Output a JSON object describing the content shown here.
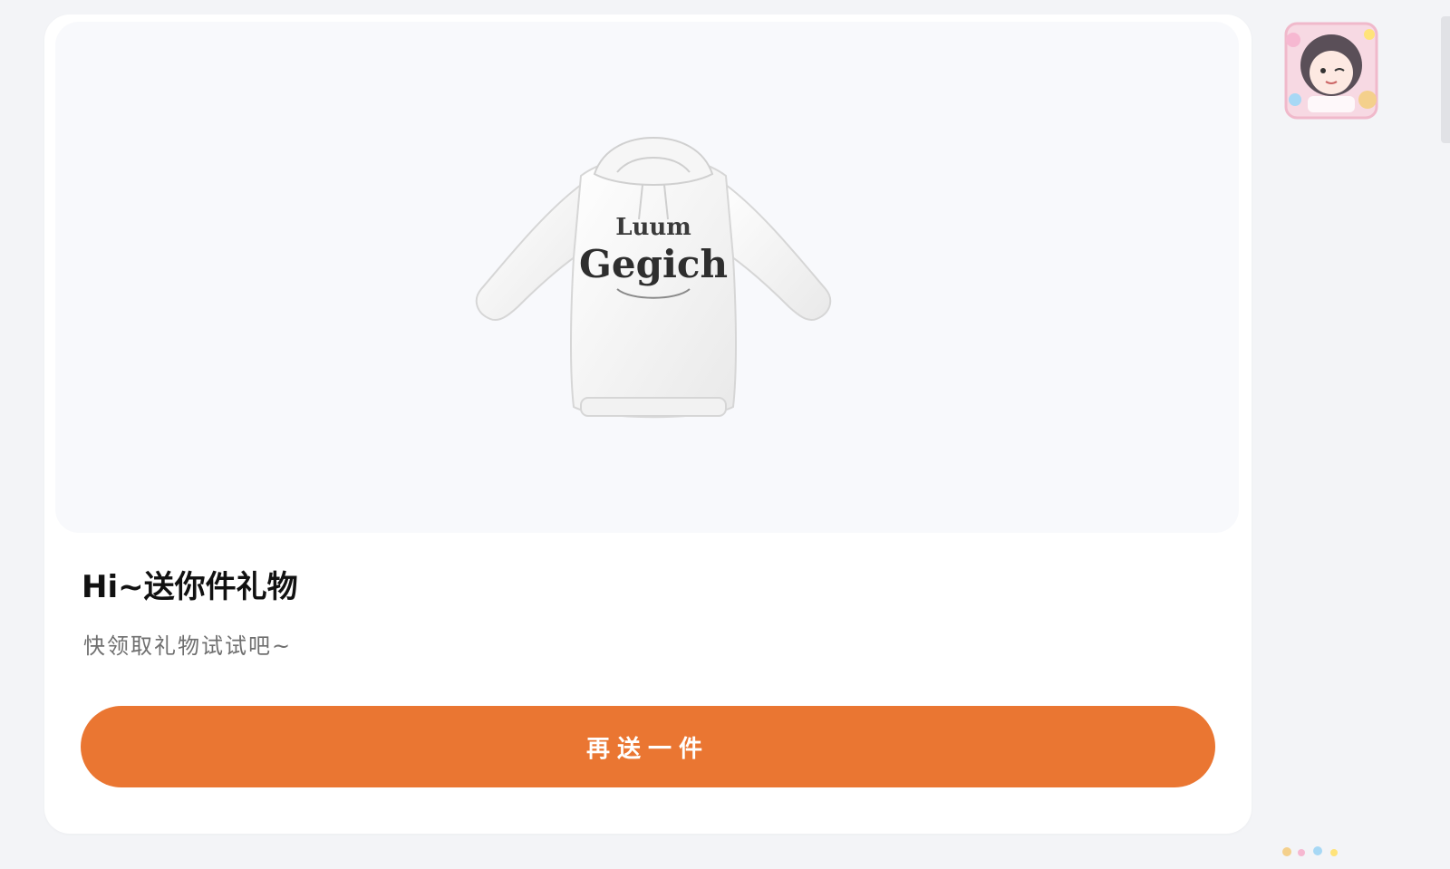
{
  "gift_card": {
    "title": "Hi~送你件礼物",
    "subtitle": "快领取礼物试试吧~",
    "button_label": "再送一件",
    "product_image": {
      "icon": "hoodie-icon",
      "print_text": "Gegich"
    }
  },
  "side": {
    "avatar_icon": "anime-sticker-avatar-icon"
  },
  "colors": {
    "page_bg": "#f3f4f7",
    "card_bg": "#ffffff",
    "image_bg": "#f8f9fc",
    "accent": "#ea7632",
    "title": "#111111",
    "subtitle": "#6f6f6f"
  }
}
